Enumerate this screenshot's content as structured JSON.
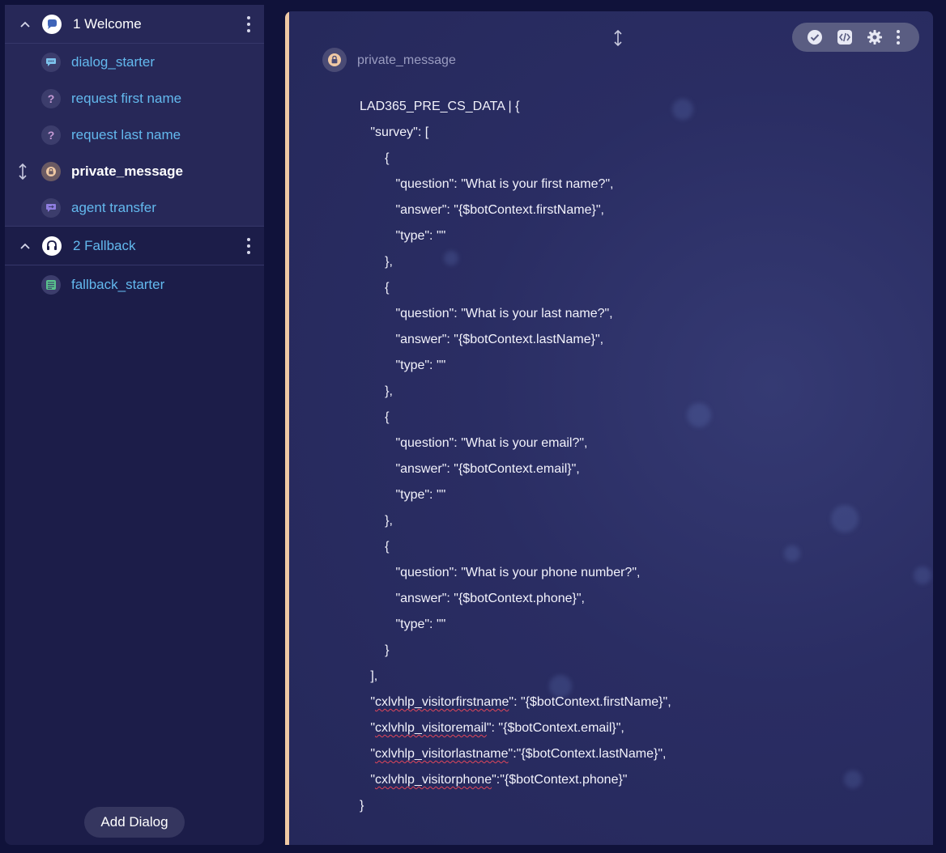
{
  "sidebar": {
    "groups": [
      {
        "title": "1 Welcome",
        "items": [
          {
            "label": "dialog_starter",
            "icon": "chat-bubble-icon"
          },
          {
            "label": "request first name",
            "icon": "question-icon",
            "glyph": "?"
          },
          {
            "label": "request last name",
            "icon": "question-icon",
            "glyph": "?"
          },
          {
            "label": "private_message",
            "icon": "lock-bubble-icon",
            "active": true
          },
          {
            "label": "agent transfer",
            "icon": "transfer-bubble-icon"
          }
        ]
      },
      {
        "title": "2 Fallback",
        "items": [
          {
            "label": "fallback_starter",
            "icon": "text-lines-icon"
          }
        ]
      }
    ],
    "add_dialog_label": "Add Dialog"
  },
  "panel": {
    "title": "private_message",
    "toolbar": [
      "check-icon",
      "code-icon",
      "gear-icon",
      "more-vertical-icon"
    ],
    "code_lines": [
      {
        "segments": [
          {
            "text": "LAD365_PRE_CS_DATA | {"
          }
        ]
      },
      {
        "segments": [
          {
            "text": "   \"survey\": ["
          }
        ]
      },
      {
        "segments": [
          {
            "text": "       {"
          }
        ]
      },
      {
        "segments": [
          {
            "text": "          \"question\": \"What is your first name?\","
          }
        ]
      },
      {
        "segments": [
          {
            "text": "          \"answer\": \"{$botContext.firstName}\","
          }
        ]
      },
      {
        "segments": [
          {
            "text": "          \"type\": \"\""
          }
        ]
      },
      {
        "segments": [
          {
            "text": "       },"
          }
        ]
      },
      {
        "segments": [
          {
            "text": "       {"
          }
        ]
      },
      {
        "segments": [
          {
            "text": "          \"question\": \"What is your last name?\","
          }
        ]
      },
      {
        "segments": [
          {
            "text": "          \"answer\": \"{$botContext.lastName}\","
          }
        ]
      },
      {
        "segments": [
          {
            "text": "          \"type\": \"\""
          }
        ]
      },
      {
        "segments": [
          {
            "text": "       },"
          }
        ]
      },
      {
        "segments": [
          {
            "text": "       {"
          }
        ]
      },
      {
        "segments": [
          {
            "text": "          \"question\": \"What is your email?\","
          }
        ]
      },
      {
        "segments": [
          {
            "text": "          \"answer\": \"{$botContext.email}\","
          }
        ]
      },
      {
        "segments": [
          {
            "text": "          \"type\": \"\""
          }
        ]
      },
      {
        "segments": [
          {
            "text": "       },"
          }
        ]
      },
      {
        "segments": [
          {
            "text": "       {"
          }
        ]
      },
      {
        "segments": [
          {
            "text": "          \"question\": \"What is your phone number?\","
          }
        ]
      },
      {
        "segments": [
          {
            "text": "          \"answer\": \"{$botContext.phone}\","
          }
        ]
      },
      {
        "segments": [
          {
            "text": "          \"type\": \"\""
          }
        ]
      },
      {
        "segments": [
          {
            "text": "       }"
          }
        ]
      },
      {
        "segments": [
          {
            "text": "   ],"
          }
        ]
      },
      {
        "segments": [
          {
            "text": "   \""
          },
          {
            "text": "cxlvhlp_visitorfirstname",
            "squiggle": true
          },
          {
            "text": "\": \"{$botContext.firstName}\","
          }
        ]
      },
      {
        "segments": [
          {
            "text": "   \""
          },
          {
            "text": "cxlvhlp_visitoremail",
            "squiggle": true
          },
          {
            "text": "\": \"{$botContext.email}\","
          }
        ]
      },
      {
        "segments": [
          {
            "text": "   \""
          },
          {
            "text": "cxlvhlp_visitorlastname",
            "squiggle": true
          },
          {
            "text": "\":\"{$botContext.lastName}\","
          }
        ]
      },
      {
        "segments": [
          {
            "text": "   \""
          },
          {
            "text": "cxlvhlp_visitorphone",
            "squiggle": true
          },
          {
            "text": "\":\"{$botContext.phone}\""
          }
        ]
      },
      {
        "segments": [
          {
            "text": "}"
          }
        ]
      }
    ]
  },
  "colors": {
    "accent_bar": "#f0c9a4",
    "link_blue": "#63b9ee",
    "spellcheck_red": "#e2465a"
  }
}
